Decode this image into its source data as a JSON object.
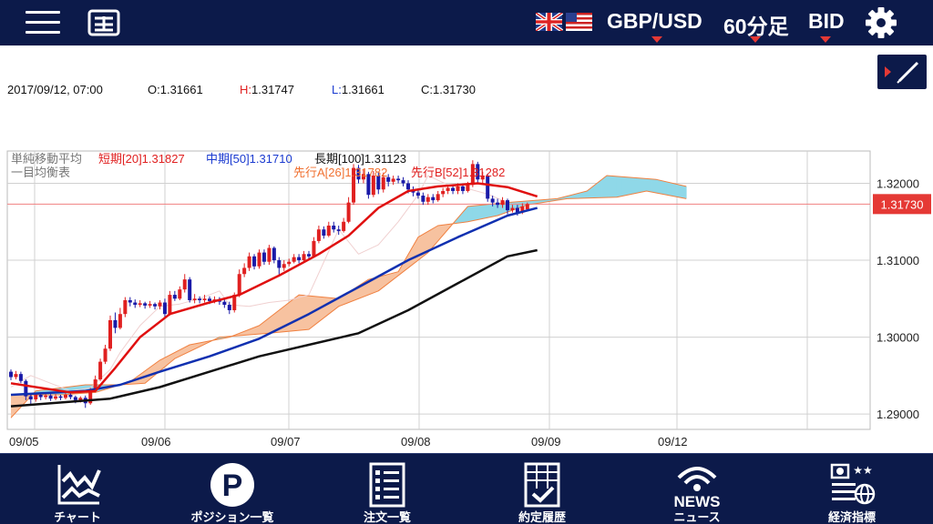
{
  "header": {
    "pair": "GBP/USD",
    "timeframe": "60分足",
    "price_type": "BID"
  },
  "info": {
    "datetime": "2017/09/12, 07:00",
    "open_label": "O:",
    "open": "1.31661",
    "high_label": "H:",
    "high": "1.31747",
    "low_label": "L:",
    "low": "1.31661",
    "close_label": "C:",
    "close": "1.31730"
  },
  "indicators": {
    "sma_title": "単純移動平均",
    "sma_short": "短期[20]1.31827",
    "sma_mid": "中期[50]1.31710",
    "sma_long": "長期[100]1.31123",
    "ichimoku_title": "一目均衡表",
    "span_a": "先行A[26]1.31782",
    "span_b": "先行B[52]1.31282"
  },
  "colors": {
    "bull": "#e02020",
    "bear": "#1a1aa8",
    "sma_short": "#e01010",
    "sma_mid": "#1030b0",
    "sma_long": "#111111",
    "cloud_bull": "#f7c2a0",
    "cloud_bear": "#8fd8e8",
    "span_line": "#f08040",
    "header_bg": "#0c1a4a"
  },
  "chart_data": {
    "type": "candlestick",
    "x_labels": [
      "09/05",
      "09/06",
      "09/07",
      "09/08",
      "09/09",
      "09/12"
    ],
    "y_ticks": [
      "1.29000",
      "1.30000",
      "1.31000",
      "1.32000"
    ],
    "ylim": [
      1.288,
      1.3242
    ],
    "current_price": "1.31730",
    "current_price_value": 1.3173,
    "candles": [
      [
        1.2955,
        1.2948,
        1.2958,
        1.2944
      ],
      [
        1.2948,
        1.2952,
        1.2956,
        1.2945
      ],
      [
        1.2952,
        1.2943,
        1.2955,
        1.294
      ],
      [
        1.2943,
        1.2923,
        1.2945,
        1.2918
      ],
      [
        1.2923,
        1.2919,
        1.2926,
        1.2913
      ],
      [
        1.2919,
        1.2925,
        1.2928,
        1.2916
      ],
      [
        1.2925,
        1.2922,
        1.2928,
        1.2918
      ],
      [
        1.2922,
        1.2924,
        1.2927,
        1.2919
      ],
      [
        1.2924,
        1.292,
        1.2926,
        1.2917
      ],
      [
        1.292,
        1.2923,
        1.2926,
        1.2918
      ],
      [
        1.2923,
        1.2921,
        1.2925,
        1.2918
      ],
      [
        1.2921,
        1.2925,
        1.2929,
        1.2919
      ],
      [
        1.2925,
        1.2922,
        1.2927,
        1.2919
      ],
      [
        1.2922,
        1.2918,
        1.2924,
        1.2914
      ],
      [
        1.2918,
        1.2921,
        1.2923,
        1.2915
      ],
      [
        1.2921,
        1.2914,
        1.2924,
        1.2908
      ],
      [
        1.2914,
        1.293,
        1.2934,
        1.2912
      ],
      [
        1.293,
        1.2945,
        1.295,
        1.2928
      ],
      [
        1.2945,
        1.2968,
        1.2972,
        1.2943
      ],
      [
        1.2968,
        1.2985,
        1.299,
        1.2965
      ],
      [
        1.2985,
        1.3022,
        1.3028,
        1.2982
      ],
      [
        1.3022,
        1.3012,
        1.3032,
        1.3005
      ],
      [
        1.3012,
        1.303,
        1.3038,
        1.301
      ],
      [
        1.303,
        1.3048,
        1.3052,
        1.3026
      ],
      [
        1.3048,
        1.3045,
        1.3052,
        1.304
      ],
      [
        1.3045,
        1.3042,
        1.3049,
        1.3038
      ],
      [
        1.3042,
        1.3044,
        1.3048,
        1.3039
      ],
      [
        1.3044,
        1.3041,
        1.3046,
        1.3037
      ],
      [
        1.3041,
        1.3043,
        1.3047,
        1.3038
      ],
      [
        1.3043,
        1.304,
        1.3045,
        1.3036
      ],
      [
        1.304,
        1.3045,
        1.3048,
        1.3036
      ],
      [
        1.3045,
        1.303,
        1.305,
        1.3026
      ],
      [
        1.303,
        1.3055,
        1.306,
        1.3028
      ],
      [
        1.3055,
        1.305,
        1.306,
        1.3047
      ],
      [
        1.305,
        1.3062,
        1.3066,
        1.3048
      ],
      [
        1.3062,
        1.3075,
        1.3082,
        1.3058
      ],
      [
        1.3075,
        1.3048,
        1.3078,
        1.3045
      ],
      [
        1.3048,
        1.305,
        1.3056,
        1.3044
      ],
      [
        1.305,
        1.3048,
        1.3053,
        1.3044
      ],
      [
        1.3048,
        1.305,
        1.3055,
        1.3045
      ],
      [
        1.305,
        1.3047,
        1.3053,
        1.3043
      ],
      [
        1.3047,
        1.3049,
        1.3053,
        1.3044
      ],
      [
        1.3049,
        1.3046,
        1.3052,
        1.3042
      ],
      [
        1.3046,
        1.3042,
        1.305,
        1.3038
      ],
      [
        1.3042,
        1.3035,
        1.3046,
        1.303
      ],
      [
        1.3035,
        1.3055,
        1.3058,
        1.3032
      ],
      [
        1.3055,
        1.3082,
        1.3088,
        1.3052
      ],
      [
        1.3082,
        1.309,
        1.3096,
        1.3078
      ],
      [
        1.309,
        1.3105,
        1.311,
        1.3086
      ],
      [
        1.3105,
        1.3092,
        1.3108,
        1.3088
      ],
      [
        1.3092,
        1.311,
        1.3114,
        1.3089
      ],
      [
        1.311,
        1.3098,
        1.3114,
        1.3094
      ],
      [
        1.3098,
        1.3116,
        1.312,
        1.3094
      ],
      [
        1.3116,
        1.31,
        1.3118,
        1.3096
      ],
      [
        1.31,
        1.309,
        1.3104,
        1.308
      ],
      [
        1.309,
        1.3095,
        1.31,
        1.3086
      ],
      [
        1.3095,
        1.3098,
        1.3102,
        1.3092
      ],
      [
        1.3098,
        1.3104,
        1.3108,
        1.3096
      ],
      [
        1.3104,
        1.31,
        1.3108,
        1.3096
      ],
      [
        1.31,
        1.3108,
        1.3112,
        1.3098
      ],
      [
        1.3108,
        1.3105,
        1.3112,
        1.3102
      ],
      [
        1.3105,
        1.3125,
        1.313,
        1.3103
      ],
      [
        1.3125,
        1.314,
        1.3145,
        1.3122
      ],
      [
        1.314,
        1.3132,
        1.3144,
        1.3128
      ],
      [
        1.3132,
        1.3145,
        1.315,
        1.313
      ],
      [
        1.3145,
        1.314,
        1.315,
        1.3136
      ],
      [
        1.314,
        1.3138,
        1.3145,
        1.3133
      ],
      [
        1.3138,
        1.315,
        1.3155,
        1.3136
      ],
      [
        1.315,
        1.3175,
        1.3182,
        1.3148
      ],
      [
        1.3175,
        1.322,
        1.3225,
        1.3172
      ],
      [
        1.322,
        1.3205,
        1.3224,
        1.32
      ],
      [
        1.3205,
        1.3212,
        1.3218,
        1.32
      ],
      [
        1.3212,
        1.3185,
        1.3215,
        1.318
      ],
      [
        1.3185,
        1.321,
        1.3216,
        1.3182
      ],
      [
        1.321,
        1.3192,
        1.3214,
        1.3186
      ],
      [
        1.3192,
        1.3208,
        1.3214,
        1.3188
      ],
      [
        1.3208,
        1.3202,
        1.3212,
        1.3196
      ],
      [
        1.3202,
        1.3206,
        1.321,
        1.3198
      ],
      [
        1.3206,
        1.3204,
        1.321,
        1.32
      ],
      [
        1.3204,
        1.32,
        1.3208,
        1.3196
      ],
      [
        1.32,
        1.3192,
        1.3204,
        1.3187
      ],
      [
        1.3192,
        1.3188,
        1.3196,
        1.3183
      ],
      [
        1.3188,
        1.3184,
        1.3192,
        1.318
      ],
      [
        1.3184,
        1.3176,
        1.3188,
        1.3172
      ],
      [
        1.3176,
        1.3182,
        1.3186,
        1.3172
      ],
      [
        1.3182,
        1.3178,
        1.3186,
        1.3174
      ],
      [
        1.3178,
        1.3186,
        1.319,
        1.3176
      ],
      [
        1.3186,
        1.319,
        1.3194,
        1.3182
      ],
      [
        1.319,
        1.3194,
        1.3198,
        1.3186
      ],
      [
        1.3194,
        1.319,
        1.3198,
        1.3186
      ],
      [
        1.319,
        1.3196,
        1.32,
        1.3186
      ],
      [
        1.3196,
        1.319,
        1.32,
        1.3186
      ],
      [
        1.319,
        1.3198,
        1.3202,
        1.3188
      ],
      [
        1.3198,
        1.3225,
        1.323,
        1.3195
      ],
      [
        1.3225,
        1.3205,
        1.3228,
        1.32
      ],
      [
        1.3205,
        1.321,
        1.3215,
        1.32
      ],
      [
        1.321,
        1.318,
        1.3212,
        1.3176
      ],
      [
        1.318,
        1.3175,
        1.3184,
        1.317
      ],
      [
        1.3175,
        1.3172,
        1.318,
        1.3168
      ],
      [
        1.3172,
        1.3178,
        1.3182,
        1.3168
      ],
      [
        1.3178,
        1.3165,
        1.318,
        1.316
      ],
      [
        1.3165,
        1.3168,
        1.3172,
        1.3162
      ],
      [
        1.3168,
        1.3162,
        1.3172,
        1.3158
      ],
      [
        1.3162,
        1.317,
        1.3174,
        1.316
      ],
      [
        1.3166,
        1.3173,
        1.3175,
        1.3166
      ]
    ],
    "series": [
      {
        "name": "短期[20]",
        "points": [
          [
            0,
            1.294
          ],
          [
            12,
            1.2928
          ],
          [
            17,
            1.293
          ],
          [
            21,
            1.296
          ],
          [
            26,
            1.3
          ],
          [
            32,
            1.303
          ],
          [
            40,
            1.3045
          ],
          [
            46,
            1.3055
          ],
          [
            54,
            1.308
          ],
          [
            62,
            1.3108
          ],
          [
            68,
            1.3132
          ],
          [
            74,
            1.3168
          ],
          [
            80,
            1.319
          ],
          [
            86,
            1.3196
          ],
          [
            94,
            1.32
          ],
          [
            100,
            1.3195
          ],
          [
            106,
            1.3183
          ]
        ]
      },
      {
        "name": "中期[50]",
        "points": [
          [
            0,
            1.2925
          ],
          [
            15,
            1.293
          ],
          [
            22,
            1.2938
          ],
          [
            30,
            1.2955
          ],
          [
            40,
            1.2975
          ],
          [
            50,
            1.2998
          ],
          [
            60,
            1.303
          ],
          [
            70,
            1.3065
          ],
          [
            80,
            1.31
          ],
          [
            90,
            1.313
          ],
          [
            100,
            1.3158
          ],
          [
            106,
            1.3168
          ]
        ]
      },
      {
        "name": "長期[100]",
        "points": [
          [
            0,
            1.291
          ],
          [
            20,
            1.292
          ],
          [
            30,
            1.2935
          ],
          [
            40,
            1.2955
          ],
          [
            50,
            1.2975
          ],
          [
            60,
            1.299
          ],
          [
            70,
            1.3005
          ],
          [
            80,
            1.3035
          ],
          [
            90,
            1.307
          ],
          [
            100,
            1.3105
          ],
          [
            106,
            1.3113
          ]
        ]
      },
      {
        "name": "先行A[26]",
        "points": [
          [
            0,
            1.2925
          ],
          [
            10,
            1.2925
          ],
          [
            17,
            1.2928
          ],
          [
            24,
            1.2942
          ],
          [
            30,
            1.297
          ],
          [
            36,
            1.299
          ],
          [
            44,
            1.3
          ],
          [
            50,
            1.3015
          ],
          [
            58,
            1.3055
          ],
          [
            66,
            1.305
          ],
          [
            72,
            1.3075
          ],
          [
            78,
            1.3085
          ],
          [
            82,
            1.313
          ],
          [
            86,
            1.3145
          ],
          [
            92,
            1.315
          ],
          [
            98,
            1.3158
          ],
          [
            104,
            1.3172
          ],
          [
            112,
            1.318
          ],
          [
            122,
            1.3182
          ],
          [
            128,
            1.319
          ],
          [
            136,
            1.318
          ]
        ]
      },
      {
        "name": "先行B[52]",
        "points": [
          [
            0,
            1.2895
          ],
          [
            5,
            1.293
          ],
          [
            15,
            1.2938
          ],
          [
            22,
            1.2938
          ],
          [
            27,
            1.294
          ],
          [
            33,
            1.2972
          ],
          [
            42,
            1.3
          ],
          [
            52,
            1.3005
          ],
          [
            60,
            1.301
          ],
          [
            66,
            1.304
          ],
          [
            74,
            1.306
          ],
          [
            84,
            1.311
          ],
          [
            92,
            1.317
          ],
          [
            100,
            1.3175
          ],
          [
            110,
            1.318
          ],
          [
            116,
            1.319
          ],
          [
            120,
            1.321
          ],
          [
            130,
            1.3205
          ],
          [
            136,
            1.3196
          ]
        ]
      },
      {
        "name": "遅行線",
        "points": [
          [
            0,
            1.2935
          ],
          [
            4,
            1.295
          ],
          [
            8,
            1.294
          ],
          [
            12,
            1.293
          ],
          [
            16,
            1.2934
          ],
          [
            20,
            1.2958
          ],
          [
            22,
            1.298
          ],
          [
            26,
            1.3015
          ],
          [
            30,
            1.304
          ],
          [
            34,
            1.3043
          ],
          [
            38,
            1.305
          ],
          [
            42,
            1.306
          ],
          [
            44,
            1.3042
          ],
          [
            48,
            1.304
          ],
          [
            52,
            1.3045
          ],
          [
            56,
            1.3048
          ],
          [
            60,
            1.3055
          ],
          [
            66,
            1.314
          ],
          [
            70,
            1.3108
          ],
          [
            74,
            1.312
          ],
          [
            78,
            1.315
          ],
          [
            82,
            1.3185
          ],
          [
            84,
            1.321
          ],
          [
            88,
            1.3198
          ],
          [
            92,
            1.3193
          ],
          [
            96,
            1.3186
          ],
          [
            100,
            1.3175
          ]
        ]
      }
    ]
  },
  "nav": [
    {
      "label": "チャート",
      "icon": "chart-icon"
    },
    {
      "label": "ポジション一覧",
      "icon": "position-icon"
    },
    {
      "label": "注文一覧",
      "icon": "order-list-icon"
    },
    {
      "label": "約定履歴",
      "icon": "execution-history-icon"
    },
    {
      "label": "ニュース",
      "icon": "news-icon",
      "icon_text": "NEWS"
    },
    {
      "label": "経済指標",
      "icon": "economic-indicator-icon"
    }
  ]
}
